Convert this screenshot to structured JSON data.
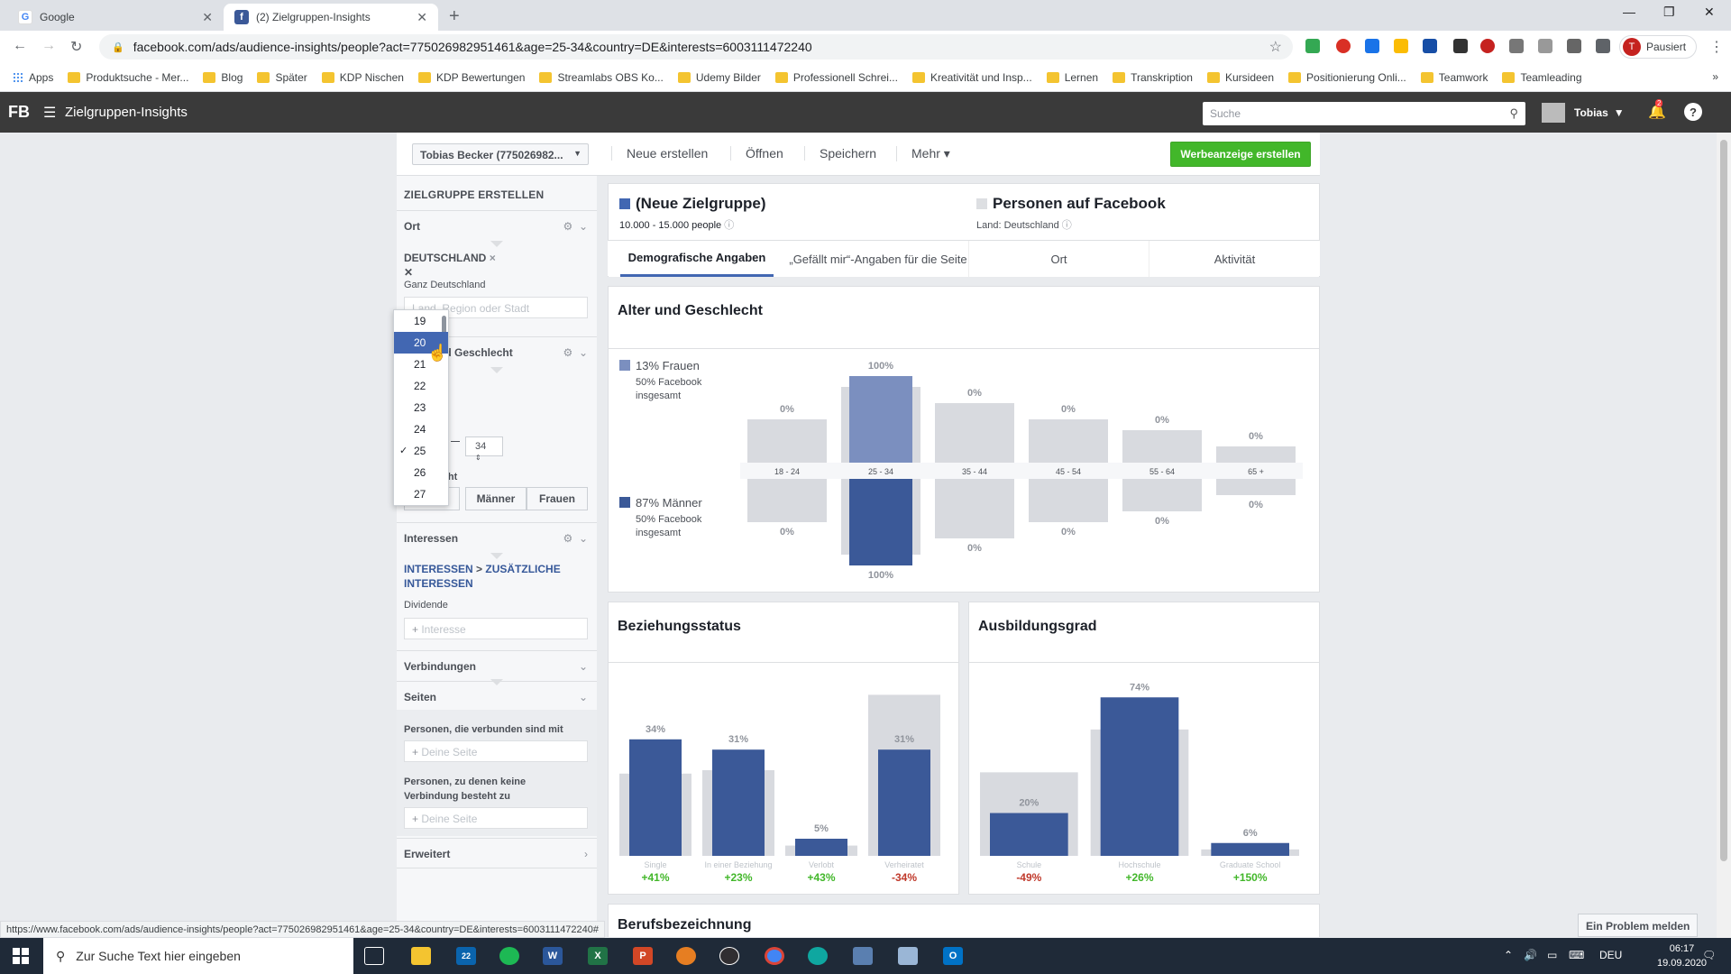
{
  "browser": {
    "tabs": [
      {
        "title": "Google",
        "favicon": "google-icon"
      },
      {
        "title": "(2) Zielgruppen-Insights",
        "favicon": "facebook-icon"
      }
    ],
    "url": "facebook.com/ads/audience-insights/people?act=775026982951461&age=25-34&country=DE&interests=6003111472240",
    "profile_label": "Pausiert",
    "profile_initial": "T",
    "bookmarks": [
      "Apps",
      "Produktsuche - Mer...",
      "Blog",
      "Später",
      "KDP Nischen",
      "KDP Bewertungen",
      "Streamlabs OBS Ko...",
      "Udemy Bilder",
      "Professionell Schrei...",
      "Kreativität und Insp...",
      "Lernen",
      "Transkription",
      "Kursideen",
      "Positionierung Onli...",
      "Teamwork",
      "Teamleading"
    ],
    "status_url": "https://www.facebook.com/ads/audience-insights/people?act=775026982951461&age=25-34&country=DE&interests=6003111472240#"
  },
  "fb": {
    "logo": "FB",
    "app_title": "Zielgruppen-Insights",
    "search_placeholder": "Suche",
    "user_name": "Tobias",
    "notif_count": "2",
    "help": "?"
  },
  "actionbar": {
    "account": "Tobias Becker (775026982...",
    "new": "Neue erstellen",
    "open": "Öffnen",
    "save": "Speichern",
    "more": "Mehr",
    "create_ad": "Werbeanzeige erstellen"
  },
  "left": {
    "heading": "ZIELGRUPPE ERSTELLEN",
    "location_label": "Ort",
    "country": "DEUTSCHLAND",
    "country_remove": "×",
    "region": "Ganz Deutschland",
    "region_placeholder": "Land, Region oder Stadt",
    "age_gender_label": "Alter und Geschlecht",
    "age_to": "34",
    "gender_label": "Geschlecht",
    "gender_buttons": [
      "Alle",
      "Männer",
      "Frauen"
    ],
    "interests_label": "Interessen",
    "interests_path_a": "INTERESSEN",
    "interests_path_sep": " > ",
    "interests_path_b": "ZUSÄTZLICHE INTERESSEN",
    "interest_value": "Dividende",
    "interest_placeholder": "Interesse",
    "connections_label": "Verbindungen",
    "pages_label": "Seiten",
    "connected_label": "Personen, die verbunden sind mit",
    "page_placeholder": "Deine Seite",
    "not_connected_label": "Personen, zu denen keine Verbindung besteht zu",
    "advanced_label": "Erweitert"
  },
  "dropdown": {
    "items": [
      "19",
      "20",
      "21",
      "22",
      "23",
      "24",
      "25",
      "26",
      "27"
    ],
    "highlighted": "20",
    "checked": "25"
  },
  "summary": {
    "audience_title": "(Neue Zielgruppe)",
    "audience_size": "10.000 - 15.000 people",
    "fb_title": "Personen auf Facebook",
    "fb_country": "Land: Deutschland",
    "audience_color": "#4267b2",
    "fb_color": "#dddfe2"
  },
  "tabs": [
    "Demografische Angaben",
    "„Gefällt mir“-Angaben für die Seite",
    "Ort",
    "Aktivität"
  ],
  "age_gender": {
    "title": "Alter und Geschlecht",
    "women_label": "13% Frauen",
    "women_fb": "50% Facebook insgesamt",
    "men_label": "87% Männer",
    "men_fb": "50% Facebook insgesamt"
  },
  "relationship": {
    "title": "Beziehungsstatus"
  },
  "education": {
    "title": "Ausbildungsgrad"
  },
  "next_section_title": "Berufsbezeichnung",
  "problem_button": "Ein Problem melden",
  "taskbar": {
    "search_placeholder": "Zur Suche Text hier eingeben",
    "lang": "DEU",
    "time": "06:17",
    "date": "19.09.2020",
    "mail_count": "22"
  },
  "chart_data": [
    {
      "type": "bar",
      "title": "Alter und Geschlecht",
      "categories": [
        "18 - 24",
        "25 - 34",
        "35 - 44",
        "45 - 54",
        "55 - 64",
        "65 +"
      ],
      "series": [
        {
          "name": "Frauen",
          "values": [
            0,
            100,
            0,
            0,
            0,
            0
          ],
          "labels": [
            "0%",
            "100%",
            "0%",
            "0%",
            "0%",
            "0%"
          ],
          "color": "#7b8fbf"
        },
        {
          "name": "Männer",
          "values": [
            0,
            100,
            0,
            0,
            0,
            0
          ],
          "labels": [
            "0%",
            "100%",
            "0%",
            "0%",
            "0%",
            "0%"
          ],
          "color": "#3b5998"
        }
      ],
      "facebook_women": [
        8,
        14,
        11,
        8,
        6,
        3
      ],
      "facebook_men": [
        8,
        14,
        11,
        8,
        6,
        3
      ]
    },
    {
      "type": "bar",
      "title": "Beziehungsstatus",
      "categories": [
        "Single",
        "In einer Beziehung",
        "Verlobt",
        "Verheiratet"
      ],
      "values": [
        34,
        31,
        5,
        31
      ],
      "labels": [
        "34%",
        "31%",
        "5%",
        "31%"
      ],
      "facebook": [
        24,
        25,
        3,
        47
      ],
      "comparison": [
        "+41%",
        "+23%",
        "+43%",
        "-34%"
      ],
      "ylim": [
        0,
        50
      ]
    },
    {
      "type": "bar",
      "title": "Ausbildungsgrad",
      "categories": [
        "Schule",
        "Hochschule",
        "Graduate School"
      ],
      "values": [
        20,
        74,
        6
      ],
      "labels": [
        "20%",
        "74%",
        "6%"
      ],
      "facebook": [
        39,
        59,
        3
      ],
      "comparison": [
        "-49%",
        "+26%",
        "+150%"
      ],
      "ylim": [
        0,
        80
      ]
    }
  ],
  "colors": {
    "accent": "#4267b2",
    "bar_dark": "#3b5998",
    "bar_light": "#7b8fbf",
    "bar_grey": "#d8dadf",
    "positive": "#42b72a",
    "negative": "#c0392b"
  }
}
